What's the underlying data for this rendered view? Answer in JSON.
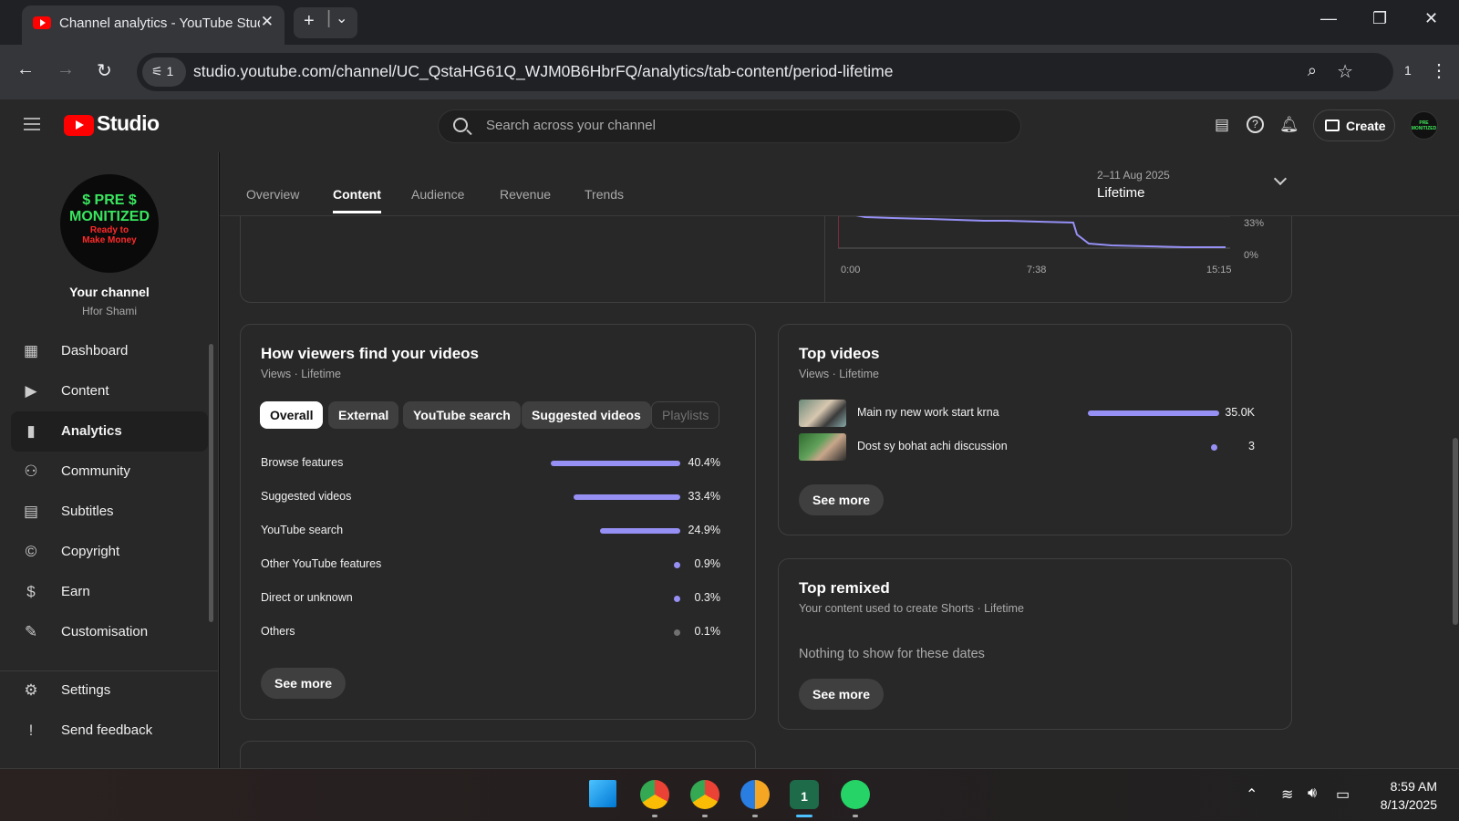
{
  "browser": {
    "tab_title": "Channel analytics - YouTube Studio",
    "tab_close": "✕",
    "new_tab": "+",
    "tab_list": "⌄",
    "url": "studio.youtube.com/channel/UC_QstaHG61Q_WJM0B6HbrFQ/analytics/tab-content/period-lifetime",
    "site_info_badge": "1",
    "extensions_count": "1",
    "window_controls": {
      "minimize": "—",
      "restore": "❐",
      "close": "✕"
    },
    "nav": {
      "back": "←",
      "forward": "→",
      "reload": "↻",
      "menu": "⋮"
    }
  },
  "studio": {
    "logo_text": "Studio",
    "search_placeholder": "Search across your channel",
    "create_label": "Create",
    "avatar_text": "PRE MONITIZED"
  },
  "sidebar": {
    "avatar_lines": [
      "$ PRE $",
      "MONITIZED",
      "Ready to",
      "Make Money"
    ],
    "your_channel": "Your channel",
    "channel_name": "Hfor Shami",
    "items": [
      {
        "label": "Dashboard",
        "icon": "dashboard-icon",
        "glyph": "▦"
      },
      {
        "label": "Content",
        "icon": "content-icon",
        "glyph": "▶"
      },
      {
        "label": "Analytics",
        "icon": "analytics-icon",
        "glyph": "▮"
      },
      {
        "label": "Community",
        "icon": "community-icon",
        "glyph": "⚇"
      },
      {
        "label": "Subtitles",
        "icon": "subtitles-icon",
        "glyph": "▤"
      },
      {
        "label": "Copyright",
        "icon": "copyright-icon",
        "glyph": "©"
      },
      {
        "label": "Earn",
        "icon": "earn-icon",
        "glyph": "$"
      },
      {
        "label": "Customisation",
        "icon": "customisation-icon",
        "glyph": "✎"
      }
    ],
    "bottom_items": [
      {
        "label": "Settings",
        "icon": "settings-icon",
        "glyph": "⚙"
      },
      {
        "label": "Send feedback",
        "icon": "feedback-icon",
        "glyph": "!"
      }
    ],
    "active": "Analytics"
  },
  "analytics": {
    "tabs": [
      "Overview",
      "Content",
      "Audience",
      "Revenue",
      "Trends"
    ],
    "active_tab": "Content",
    "period_range": "2–11 Aug 2025",
    "period_label": "Lifetime"
  },
  "retention_chart": {
    "y_ticks": [
      "33%",
      "0%"
    ],
    "x_ticks": [
      "0:00",
      "7:38",
      "15:15"
    ]
  },
  "traffic_sources": {
    "title": "How viewers find your videos",
    "subtitle": "Views · Lifetime",
    "chips": [
      "Overall",
      "External",
      "YouTube search",
      "Suggested videos",
      "Playlists"
    ],
    "selected_chip": "Overall",
    "disabled_chip": "Playlists",
    "rows": [
      {
        "name": "Browse features",
        "pct": "40.4%",
        "value": 40.4
      },
      {
        "name": "Suggested videos",
        "pct": "33.4%",
        "value": 33.4
      },
      {
        "name": "YouTube search",
        "pct": "24.9%",
        "value": 24.9
      },
      {
        "name": "Other YouTube features",
        "pct": "0.9%",
        "value": 0.9
      },
      {
        "name": "Direct or unknown",
        "pct": "0.3%",
        "value": 0.3
      },
      {
        "name": "Others",
        "pct": "0.1%",
        "value": 0.1
      }
    ],
    "see_more": "See more"
  },
  "top_videos": {
    "title": "Top videos",
    "subtitle": "Views · Lifetime",
    "rows": [
      {
        "title": "Main ny new work start krna",
        "views": "35.0K",
        "value": 35000
      },
      {
        "title": "Dost sy bohat achi discussion",
        "views": "3",
        "value": 3
      }
    ],
    "see_more": "See more"
  },
  "top_remixed": {
    "title": "Top remixed",
    "subtitle": "Your content used to create Shorts · Lifetime",
    "empty_text": "Nothing to show for these dates",
    "see_more": "See more"
  },
  "taskbar": {
    "time": "8:59 AM",
    "date": "8/13/2025",
    "apps": [
      "windows-start-icon",
      "chrome-icon",
      "chrome-profile-icon",
      "app-x-icon",
      "notification-app-icon",
      "whatsapp-icon"
    ],
    "app_badge": "1",
    "tray_up": "⌃"
  },
  "colors": {
    "accent_bar": "#9690f5",
    "youtube_red": "#ff0000",
    "background": "#282828"
  }
}
